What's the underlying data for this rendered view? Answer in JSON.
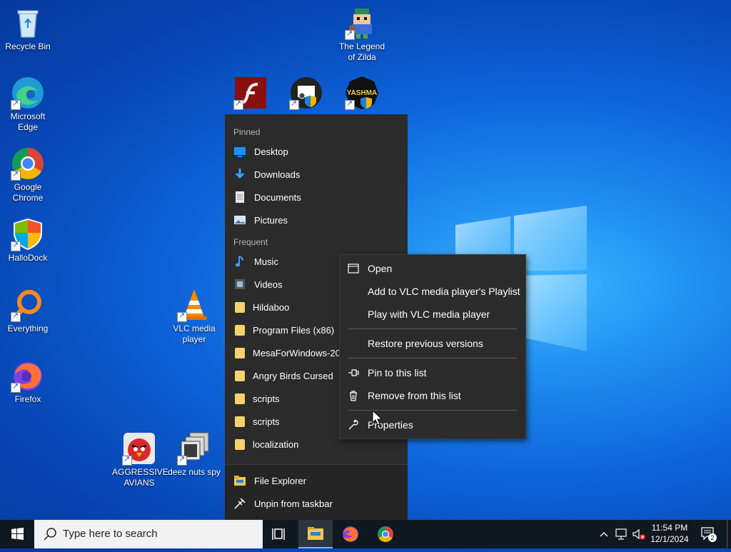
{
  "desktop": {
    "icons": [
      {
        "id": "recycle-bin",
        "label": "Recycle Bin"
      },
      {
        "id": "legend-of-zilda",
        "label": "The Legend of Zilda"
      },
      {
        "id": "edge",
        "label": "Microsoft Edge"
      },
      {
        "id": "chrome",
        "label": "Google Chrome"
      },
      {
        "id": "hallodock",
        "label": "HalloDock"
      },
      {
        "id": "everything",
        "label": "Everything"
      },
      {
        "id": "vlc",
        "label": "VLC media player"
      },
      {
        "id": "firefox",
        "label": "Firefox"
      },
      {
        "id": "aggressive-avians",
        "label": "AGGRESSIVE AVIANS"
      },
      {
        "id": "deez-nuts-spy",
        "label": "deez nuts spy"
      }
    ],
    "unlabeled_icons": [
      "flash-icon",
      "monitor-shield-icon",
      "yashma-icon"
    ],
    "yashma_text": "YASHMA"
  },
  "jumplist": {
    "pinned_header": "Pinned",
    "pinned": [
      {
        "label": "Desktop",
        "icon": "desktop-icon"
      },
      {
        "label": "Downloads",
        "icon": "download-arrow-icon"
      },
      {
        "label": "Documents",
        "icon": "document-icon"
      },
      {
        "label": "Pictures",
        "icon": "pictures-icon"
      }
    ],
    "frequent_header": "Frequent",
    "frequent": [
      {
        "label": "Music",
        "icon": "music-note-icon"
      },
      {
        "label": "Videos",
        "icon": "video-icon"
      },
      {
        "label": "Hildaboo",
        "icon": "folder-icon"
      },
      {
        "label": "Program Files (x86)",
        "icon": "folder-icon"
      },
      {
        "label": "MesaForWindows-20.1",
        "icon": "folder-icon"
      },
      {
        "label": "Angry Birds Cursed",
        "icon": "folder-icon"
      },
      {
        "label": "scripts",
        "icon": "folder-icon"
      },
      {
        "label": "scripts",
        "icon": "folder-icon"
      },
      {
        "label": "localization",
        "icon": "folder-icon"
      }
    ],
    "bottom": [
      {
        "label": "File Explorer",
        "icon": "file-explorer-icon"
      },
      {
        "label": "Unpin from taskbar",
        "icon": "unpin-icon"
      }
    ]
  },
  "context_menu": {
    "items": [
      {
        "label": "Open",
        "icon": "window-icon"
      },
      {
        "label": "Add to VLC media player's Playlist",
        "icon": ""
      },
      {
        "label": "Play with VLC media player",
        "icon": ""
      },
      {
        "label": "Restore previous versions",
        "icon": ""
      },
      {
        "label": "Pin to this list",
        "icon": "pin-icon"
      },
      {
        "label": "Remove from this list",
        "icon": "trash-icon"
      },
      {
        "label": "Properties",
        "icon": "wrench-icon"
      }
    ]
  },
  "taskbar": {
    "search_placeholder": "Type here to search",
    "time": "11:54 PM",
    "date": "12/1/2024",
    "notification_count": "2"
  },
  "colors": {
    "accent": "#0a64d8",
    "menu_bg": "#2b2b2b",
    "taskbar_bg": "#101820"
  }
}
